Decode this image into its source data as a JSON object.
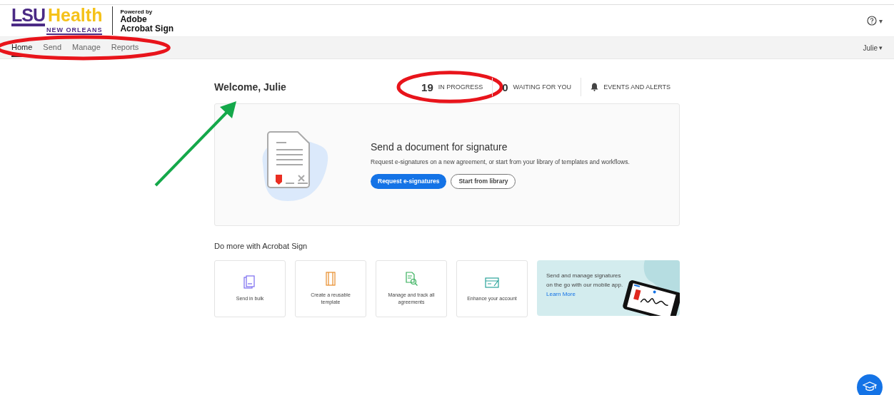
{
  "header": {
    "logo": {
      "part_1": "LSU",
      "part_2": "Health",
      "subtitle": "NEW ORLEANS"
    },
    "powered_by": {
      "line_1": "Powered by",
      "line_2": "Adobe",
      "line_3": "Acrobat Sign"
    },
    "help_caret": "▾"
  },
  "nav": {
    "items": [
      {
        "label": "Home",
        "selected": true
      },
      {
        "label": "Send",
        "selected": false
      },
      {
        "label": "Manage",
        "selected": false
      },
      {
        "label": "Reports",
        "selected": false
      }
    ],
    "user": "Julie",
    "user_caret": "▾"
  },
  "welcome": "Welcome, Julie",
  "stats": [
    {
      "kind": "count",
      "count": "19",
      "label": "IN PROGRESS"
    },
    {
      "kind": "count",
      "count": "0",
      "label": "WAITING FOR YOU"
    },
    {
      "kind": "bell",
      "label": "EVENTS AND ALERTS"
    }
  ],
  "hero": {
    "title": "Send a document for signature",
    "text": "Request e-signatures on a new agreement, or start from your library of templates and workflows.",
    "buttons": [
      {
        "label": "Request e-signatures",
        "kind": "primary"
      },
      {
        "label": "Start from library",
        "kind": "secondary"
      }
    ]
  },
  "more": {
    "title": "Do more with Acrobat Sign",
    "tiles": [
      {
        "kind": "bulk",
        "label": "Send in bulk"
      },
      {
        "kind": "template",
        "label": "Create a reusable template"
      },
      {
        "kind": "manage",
        "label": "Manage and track all agreements"
      },
      {
        "kind": "account",
        "label": "Enhance your account"
      }
    ],
    "promo": {
      "text": "Send and manage signatures on the go with our mobile app.",
      "link": "Learn More"
    }
  },
  "annotations": [
    {
      "kind": "ellipse",
      "color": "#e8141b"
    },
    {
      "kind": "ellipse",
      "color": "#e8141b"
    },
    {
      "kind": "arrow",
      "color": "#14a84a"
    }
  ]
}
